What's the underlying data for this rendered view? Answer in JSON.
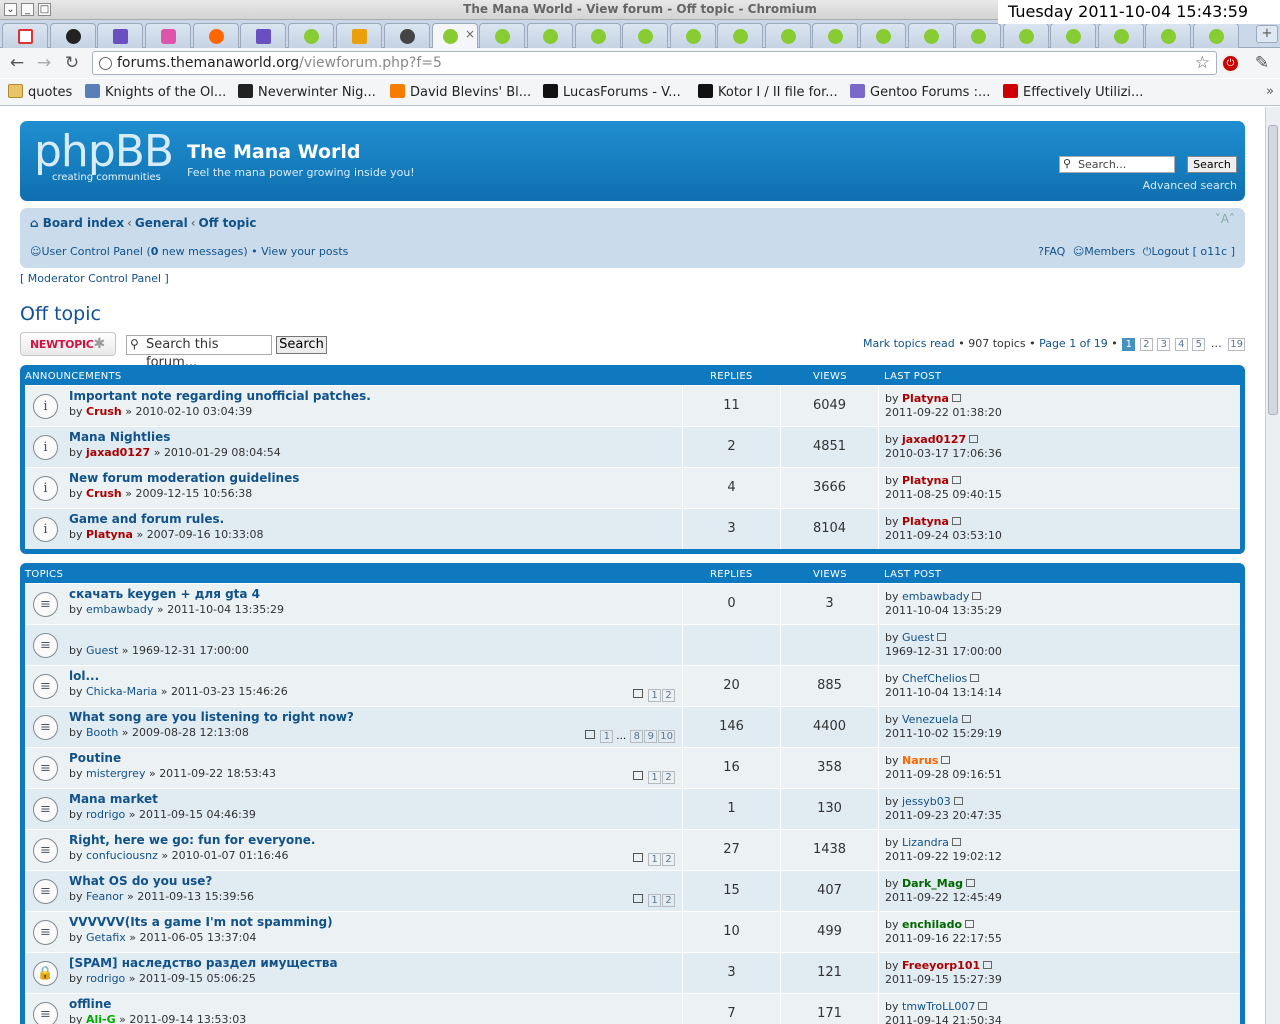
{
  "window": {
    "title": "The Mana World - View forum - Off topic - Chromium"
  },
  "clock": "Tuesday 2011-10-04 15:43:59",
  "browser": {
    "url_host": "forums.themanaworld.org",
    "url_path": "/viewforum.php?f=5",
    "bookmarks": [
      "quotes",
      "Knights of the Ol...",
      "Neverwinter Nig...",
      "David Blevins' Bl...",
      "LucasForums - V...",
      "Kotor I / II file for...",
      "Gentoo Forums :...",
      "Effectively Utilizi..."
    ]
  },
  "header": {
    "logo": "phpBB",
    "logo_sub": "creating   communities",
    "site_title": "The Mana World",
    "site_desc": "Feel the mana power growing inside you!",
    "search_placeholder": "Search...",
    "search_btn": "Search",
    "advanced": "Advanced search"
  },
  "navbar": {
    "crumb1": "Board index",
    "crumb2": "General",
    "crumb3": "Off topic",
    "fontsize": "˅A˄",
    "ucp_pre": "User Control Panel (",
    "ucp_count": "0",
    "ucp_post": " new messages)",
    "view_posts": "View your posts",
    "faq": "FAQ",
    "members": "Members",
    "logout": "Logout [ o11c ]",
    "mcp": "[ Moderator Control Panel ]"
  },
  "forum": {
    "title": "Off topic",
    "newtopic": "NEWTOPIC",
    "search_placeholder": "Search this forum...",
    "search_btn": "Search",
    "mark_read": "Mark topics read",
    "topic_count": "907 topics",
    "page_info": "Page 1 of 19",
    "pages": [
      "1",
      "2",
      "3",
      "4",
      "5"
    ],
    "last_page": "19"
  },
  "columns": {
    "announcements": "ANNOUNCEMENTS",
    "topics": "TOPICS",
    "replies": "REPLIES",
    "views": "VIEWS",
    "lastpost": "LAST POST"
  },
  "announcements": [
    {
      "title": "Important note regarding unofficial patches.",
      "author": "Crush",
      "date": "2010-02-10 03:04:39",
      "replies": "11",
      "views": "6049",
      "lp_author": "Platyna",
      "lp_date": "2011-09-22 01:38:20",
      "icon": "info-icon"
    },
    {
      "title": "Mana Nightlies",
      "author": "jaxad0127",
      "date": "2010-01-29 08:04:54",
      "replies": "2",
      "views": "4851",
      "lp_author": "jaxad0127",
      "lp_date": "2010-03-17 17:06:36",
      "icon": "info-locked-icon"
    },
    {
      "title": "New forum moderation guidelines",
      "author": "Crush",
      "date": "2009-12-15 10:56:38",
      "replies": "4",
      "views": "3666",
      "lp_author": "Platyna",
      "lp_date": "2011-08-25 09:40:15",
      "icon": "info-icon"
    },
    {
      "title": "Game and forum rules.",
      "author": "Platyna",
      "date": "2007-09-16 10:33:08",
      "replies": "3",
      "views": "8104",
      "lp_author": "Platyna",
      "lp_date": "2011-09-24 03:53:10",
      "icon": "info-locked-icon"
    }
  ],
  "topics": [
    {
      "title": "скачать keygen + для gta 4",
      "author": "embawbady",
      "date": "2011-10-04 13:35:29",
      "replies": "0",
      "views": "3",
      "lp_author": "embawbady",
      "lp_date": "2011-10-04 13:35:29",
      "pages": ""
    },
    {
      "title": "",
      "author": "Guest",
      "date": "1969-12-31 17:00:00",
      "replies": "",
      "views": "",
      "lp_author": "Guest",
      "lp_date": "1969-12-31 17:00:00",
      "pages": ""
    },
    {
      "title": "lol...",
      "author": "Chicka-Maria",
      "date": "2011-03-23 15:46:26",
      "replies": "20",
      "views": "885",
      "lp_author": "ChefChelios",
      "lp_date": "2011-10-04 13:14:14",
      "pages": "1 2"
    },
    {
      "title": "What song are you listening to right now?",
      "author": "Booth",
      "date": "2009-08-28 12:13:08",
      "replies": "146",
      "views": "4400",
      "lp_author": "Venezuela",
      "lp_date": "2011-10-02 15:29:19",
      "pages": "1 … 8 9 10"
    },
    {
      "title": "Poutine",
      "author": "mistergrey",
      "date": "2011-09-22 18:53:43",
      "replies": "16",
      "views": "358",
      "lp_author": "Narus",
      "lp_date": "2011-09-28 09:16:51",
      "pages": "1 2"
    },
    {
      "title": "Mana market",
      "author": "rodrigo",
      "date": "2011-09-15 04:46:39",
      "replies": "1",
      "views": "130",
      "lp_author": "jessyb03",
      "lp_date": "2011-09-23 20:47:35",
      "pages": ""
    },
    {
      "title": "Right, here we go: fun for everyone.",
      "author": "confuciousnz",
      "date": "2010-01-07 01:16:46",
      "replies": "27",
      "views": "1438",
      "lp_author": "Lizandra",
      "lp_date": "2011-09-22 19:02:12",
      "pages": "1 2"
    },
    {
      "title": "What OS do you use?",
      "author": "Feanor",
      "date": "2011-09-13 15:39:56",
      "replies": "15",
      "views": "407",
      "lp_author": "Dark_Mag",
      "lp_date": "2011-09-22 12:45:49",
      "pages": "1 2"
    },
    {
      "title": "VVVVVV(Its a game I'm not spamming)",
      "author": "Getafix",
      "date": "2011-06-05 13:37:04",
      "replies": "10",
      "views": "499",
      "lp_author": "enchilado",
      "lp_date": "2011-09-16 22:17:55",
      "pages": ""
    },
    {
      "title": "[SPAM] наследство раздел имущества",
      "author": "rodrigo",
      "date": "2011-09-15 05:06:25",
      "replies": "3",
      "views": "121",
      "lp_author": "Freeyorp101",
      "lp_date": "2011-09-15 15:27:39",
      "pages": ""
    },
    {
      "title": "offline",
      "author": "Ali-G",
      "date": "2011-09-14 13:53:03",
      "replies": "7",
      "views": "171",
      "lp_author": "tmwTroLL007",
      "lp_date": "2011-09-14 21:50:34",
      "pages": ""
    }
  ],
  "colors": {
    "header": "#1374b9",
    "link": "#105289",
    "red_user": "#aa0000",
    "green_user": "#00aa00"
  }
}
